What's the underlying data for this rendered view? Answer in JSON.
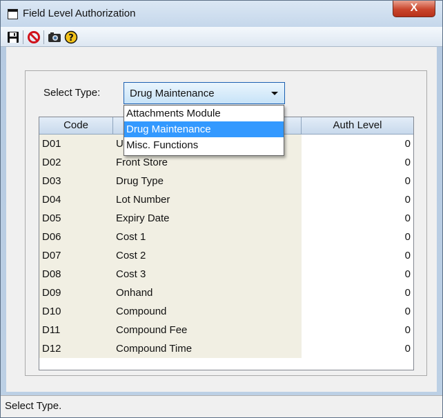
{
  "window": {
    "title": "Field Level Authorization",
    "close_label": "X"
  },
  "toolbar": {
    "buttons": [
      {
        "name": "save-icon",
        "icon": "save-icon"
      },
      {
        "name": "cancel-icon",
        "icon": "cancel-icon"
      },
      {
        "name": "camera-icon",
        "icon": "camera-icon"
      },
      {
        "name": "help-icon",
        "icon": "help-icon",
        "glyph": "?"
      }
    ]
  },
  "select_type": {
    "label": "Select Type:",
    "value": "Drug Maintenance",
    "options": [
      "Attachments Module",
      "Drug Maintenance",
      "Misc. Functions"
    ],
    "selected_index": 1
  },
  "grid": {
    "headers": {
      "code": "Code",
      "description": "",
      "auth_level": "Auth Level"
    },
    "rows": [
      {
        "code": "D01",
        "description": "U",
        "auth_level": "0"
      },
      {
        "code": "D02",
        "description": "Front Store",
        "auth_level": "0"
      },
      {
        "code": "D03",
        "description": "Drug Type",
        "auth_level": "0"
      },
      {
        "code": "D04",
        "description": "Lot Number",
        "auth_level": "0"
      },
      {
        "code": "D05",
        "description": "Expiry Date",
        "auth_level": "0"
      },
      {
        "code": "D06",
        "description": "Cost 1",
        "auth_level": "0"
      },
      {
        "code": "D07",
        "description": "Cost 2",
        "auth_level": "0"
      },
      {
        "code": "D08",
        "description": "Cost 3",
        "auth_level": "0"
      },
      {
        "code": "D09",
        "description": "Onhand",
        "auth_level": "0"
      },
      {
        "code": "D10",
        "description": "Compound",
        "auth_level": "0"
      },
      {
        "code": "D11",
        "description": "Compound Fee",
        "auth_level": "0"
      },
      {
        "code": "D12",
        "description": "Compound Time",
        "auth_level": "0"
      }
    ]
  },
  "statusbar": {
    "text": "Select Type."
  },
  "colors": {
    "selection": "#3399ff",
    "close_button": "#c9452c",
    "grid_tint": "#f1efe3"
  }
}
